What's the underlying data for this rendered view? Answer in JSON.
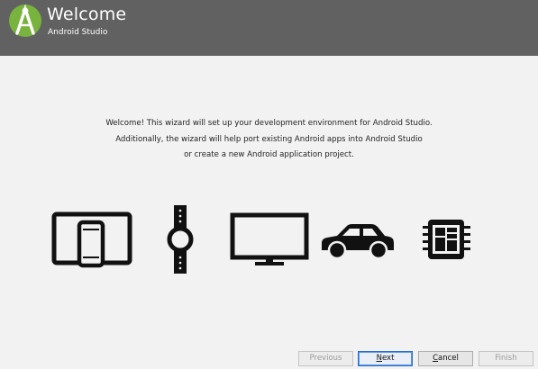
{
  "header": {
    "title": "Welcome",
    "subtitle": "Android Studio",
    "background_color": "#616161",
    "logo_icon": "android-studio-logo-icon"
  },
  "message": {
    "lines": [
      "Welcome! This wizard will set up your development environment for Android Studio.",
      "Additionally, the wizard will help port existing Android apps into Android Studio",
      "or create a new Android application project."
    ]
  },
  "device_icons": [
    "tablet-phone-icon",
    "watch-icon",
    "tv-icon",
    "car-icon",
    "things-board-icon"
  ],
  "buttons": {
    "previous": {
      "label": "Previous",
      "enabled": false
    },
    "next": {
      "pre": "",
      "mnemonic": "N",
      "post": "ext",
      "enabled": true
    },
    "cancel": {
      "pre": "",
      "mnemonic": "C",
      "post": "ancel",
      "enabled": true
    },
    "finish": {
      "label": "Finish",
      "enabled": false
    }
  }
}
